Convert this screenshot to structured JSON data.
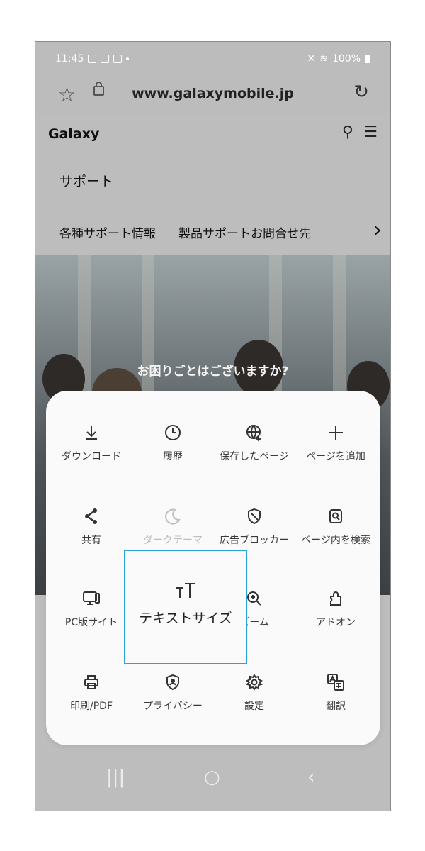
{
  "status_bar": {
    "time": "11:45",
    "battery": "100%"
  },
  "address_bar": {
    "url": "www.galaxymobile.jp"
  },
  "site": {
    "logo": "Galaxy",
    "section_title": "サポート",
    "subnav": [
      "各種サポート情報",
      "製品サポートお問合せ先"
    ],
    "subnav_fade": "",
    "hero_caption": "お困りごとはございますか?"
  },
  "menu": {
    "items": [
      {
        "label": "ダウンロード",
        "icon": "download-icon"
      },
      {
        "label": "履歴",
        "icon": "clock-icon"
      },
      {
        "label": "保存したページ",
        "icon": "saved-pages-icon"
      },
      {
        "label": "ページを追加",
        "icon": "plus-icon"
      },
      {
        "label": "共有",
        "icon": "share-icon"
      },
      {
        "label": "ダークテーマ",
        "icon": "moon-icon"
      },
      {
        "label": "広告ブロッカー",
        "icon": "shield-icon"
      },
      {
        "label": "ページ内を検索",
        "icon": "find-in-page-icon"
      },
      {
        "label": "PC版サイト",
        "icon": "desktop-icon"
      },
      {
        "label": "テキストサイズ",
        "icon": "text-size-icon"
      },
      {
        "label": "ズーム",
        "icon": "zoom-icon"
      },
      {
        "label": "アドオン",
        "icon": "puzzle-icon"
      },
      {
        "label": "印刷/PDF",
        "icon": "printer-icon"
      },
      {
        "label": "プライバシー",
        "icon": "privacy-icon"
      },
      {
        "label": "設定",
        "icon": "gear-icon"
      },
      {
        "label": "翻訳",
        "icon": "translate-icon"
      }
    ],
    "highlighted": "テキストサイズ",
    "highlight_color": "#2aa3d6"
  }
}
